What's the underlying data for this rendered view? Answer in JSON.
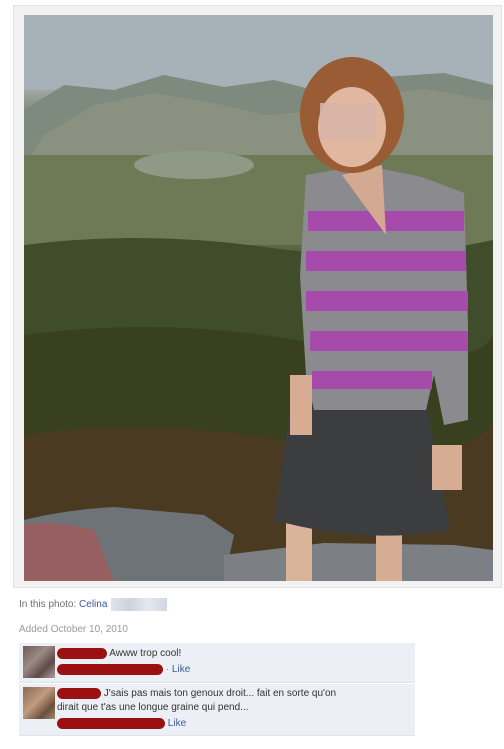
{
  "photo": {
    "alt": "photo"
  },
  "caption": {
    "in_this_photo_label": "In this photo:",
    "tagged_name": "Celina",
    "added": "Added October 10, 2010"
  },
  "comments": [
    {
      "text": "Awww trop cool!",
      "separator": "·",
      "like_label": "Like"
    },
    {
      "text_line1": "J'sais pas mais ton genoux droit... fait en sorte qu'on",
      "text_line2": "dirait que t'as une longue graine qui pend...",
      "like_label": "Like"
    }
  ],
  "colors": {
    "link": "#3b5998",
    "redaction": "#9b1111",
    "comment_bg": "#eceff5"
  }
}
